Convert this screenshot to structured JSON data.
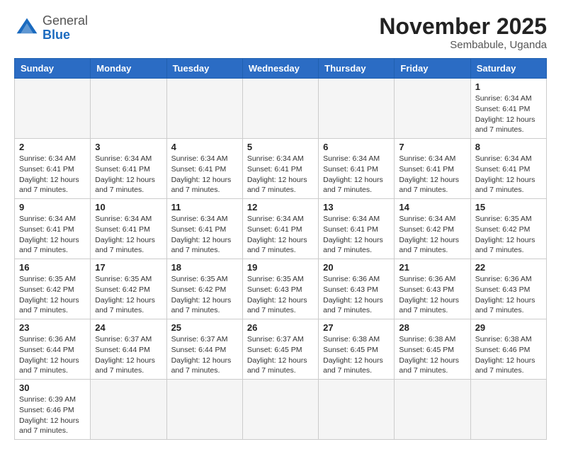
{
  "header": {
    "logo_general": "General",
    "logo_blue": "Blue",
    "month_title": "November 2025",
    "location": "Sembabule, Uganda"
  },
  "weekdays": [
    "Sunday",
    "Monday",
    "Tuesday",
    "Wednesday",
    "Thursday",
    "Friday",
    "Saturday"
  ],
  "weeks": [
    [
      {
        "day": "",
        "info": ""
      },
      {
        "day": "",
        "info": ""
      },
      {
        "day": "",
        "info": ""
      },
      {
        "day": "",
        "info": ""
      },
      {
        "day": "",
        "info": ""
      },
      {
        "day": "",
        "info": ""
      },
      {
        "day": "1",
        "info": "Sunrise: 6:34 AM\nSunset: 6:41 PM\nDaylight: 12 hours and 7 minutes."
      }
    ],
    [
      {
        "day": "2",
        "info": "Sunrise: 6:34 AM\nSunset: 6:41 PM\nDaylight: 12 hours and 7 minutes."
      },
      {
        "day": "3",
        "info": "Sunrise: 6:34 AM\nSunset: 6:41 PM\nDaylight: 12 hours and 7 minutes."
      },
      {
        "day": "4",
        "info": "Sunrise: 6:34 AM\nSunset: 6:41 PM\nDaylight: 12 hours and 7 minutes."
      },
      {
        "day": "5",
        "info": "Sunrise: 6:34 AM\nSunset: 6:41 PM\nDaylight: 12 hours and 7 minutes."
      },
      {
        "day": "6",
        "info": "Sunrise: 6:34 AM\nSunset: 6:41 PM\nDaylight: 12 hours and 7 minutes."
      },
      {
        "day": "7",
        "info": "Sunrise: 6:34 AM\nSunset: 6:41 PM\nDaylight: 12 hours and 7 minutes."
      },
      {
        "day": "8",
        "info": "Sunrise: 6:34 AM\nSunset: 6:41 PM\nDaylight: 12 hours and 7 minutes."
      }
    ],
    [
      {
        "day": "9",
        "info": "Sunrise: 6:34 AM\nSunset: 6:41 PM\nDaylight: 12 hours and 7 minutes."
      },
      {
        "day": "10",
        "info": "Sunrise: 6:34 AM\nSunset: 6:41 PM\nDaylight: 12 hours and 7 minutes."
      },
      {
        "day": "11",
        "info": "Sunrise: 6:34 AM\nSunset: 6:41 PM\nDaylight: 12 hours and 7 minutes."
      },
      {
        "day": "12",
        "info": "Sunrise: 6:34 AM\nSunset: 6:41 PM\nDaylight: 12 hours and 7 minutes."
      },
      {
        "day": "13",
        "info": "Sunrise: 6:34 AM\nSunset: 6:41 PM\nDaylight: 12 hours and 7 minutes."
      },
      {
        "day": "14",
        "info": "Sunrise: 6:34 AM\nSunset: 6:42 PM\nDaylight: 12 hours and 7 minutes."
      },
      {
        "day": "15",
        "info": "Sunrise: 6:35 AM\nSunset: 6:42 PM\nDaylight: 12 hours and 7 minutes."
      }
    ],
    [
      {
        "day": "16",
        "info": "Sunrise: 6:35 AM\nSunset: 6:42 PM\nDaylight: 12 hours and 7 minutes."
      },
      {
        "day": "17",
        "info": "Sunrise: 6:35 AM\nSunset: 6:42 PM\nDaylight: 12 hours and 7 minutes."
      },
      {
        "day": "18",
        "info": "Sunrise: 6:35 AM\nSunset: 6:42 PM\nDaylight: 12 hours and 7 minutes."
      },
      {
        "day": "19",
        "info": "Sunrise: 6:35 AM\nSunset: 6:43 PM\nDaylight: 12 hours and 7 minutes."
      },
      {
        "day": "20",
        "info": "Sunrise: 6:36 AM\nSunset: 6:43 PM\nDaylight: 12 hours and 7 minutes."
      },
      {
        "day": "21",
        "info": "Sunrise: 6:36 AM\nSunset: 6:43 PM\nDaylight: 12 hours and 7 minutes."
      },
      {
        "day": "22",
        "info": "Sunrise: 6:36 AM\nSunset: 6:43 PM\nDaylight: 12 hours and 7 minutes."
      }
    ],
    [
      {
        "day": "23",
        "info": "Sunrise: 6:36 AM\nSunset: 6:44 PM\nDaylight: 12 hours and 7 minutes."
      },
      {
        "day": "24",
        "info": "Sunrise: 6:37 AM\nSunset: 6:44 PM\nDaylight: 12 hours and 7 minutes."
      },
      {
        "day": "25",
        "info": "Sunrise: 6:37 AM\nSunset: 6:44 PM\nDaylight: 12 hours and 7 minutes."
      },
      {
        "day": "26",
        "info": "Sunrise: 6:37 AM\nSunset: 6:45 PM\nDaylight: 12 hours and 7 minutes."
      },
      {
        "day": "27",
        "info": "Sunrise: 6:38 AM\nSunset: 6:45 PM\nDaylight: 12 hours and 7 minutes."
      },
      {
        "day": "28",
        "info": "Sunrise: 6:38 AM\nSunset: 6:45 PM\nDaylight: 12 hours and 7 minutes."
      },
      {
        "day": "29",
        "info": "Sunrise: 6:38 AM\nSunset: 6:46 PM\nDaylight: 12 hours and 7 minutes."
      }
    ],
    [
      {
        "day": "30",
        "info": "Sunrise: 6:39 AM\nSunset: 6:46 PM\nDaylight: 12 hours and 7 minutes."
      },
      {
        "day": "",
        "info": ""
      },
      {
        "day": "",
        "info": ""
      },
      {
        "day": "",
        "info": ""
      },
      {
        "day": "",
        "info": ""
      },
      {
        "day": "",
        "info": ""
      },
      {
        "day": "",
        "info": ""
      }
    ]
  ]
}
